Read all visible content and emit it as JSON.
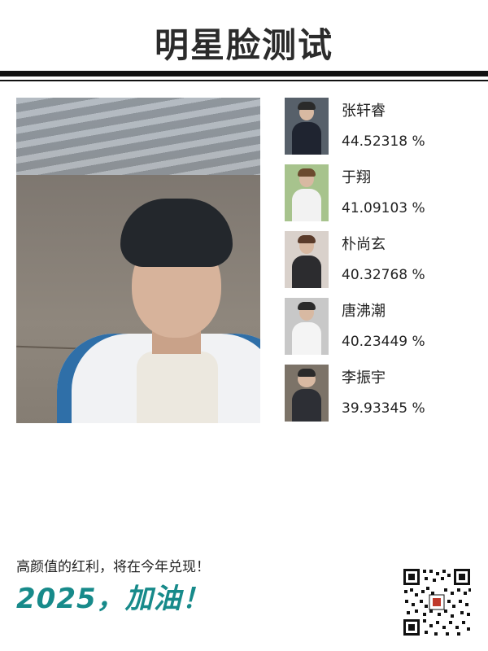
{
  "title": "明星脸测试",
  "results": [
    {
      "name": "张轩睿",
      "score": "44.52318 %"
    },
    {
      "name": "于翔",
      "score": "41.09103 %"
    },
    {
      "name": "朴尚玄",
      "score": "40.32768 %"
    },
    {
      "name": "唐沸潮",
      "score": "40.23449 %"
    },
    {
      "name": "李振宇",
      "score": "39.93345 %"
    }
  ],
  "footer": {
    "line": "高颜值的红利，将在今年兑现！",
    "slogan": "2025，加油！"
  },
  "colors": {
    "slogan": "#178a8a",
    "title": "#2b2b2b"
  }
}
